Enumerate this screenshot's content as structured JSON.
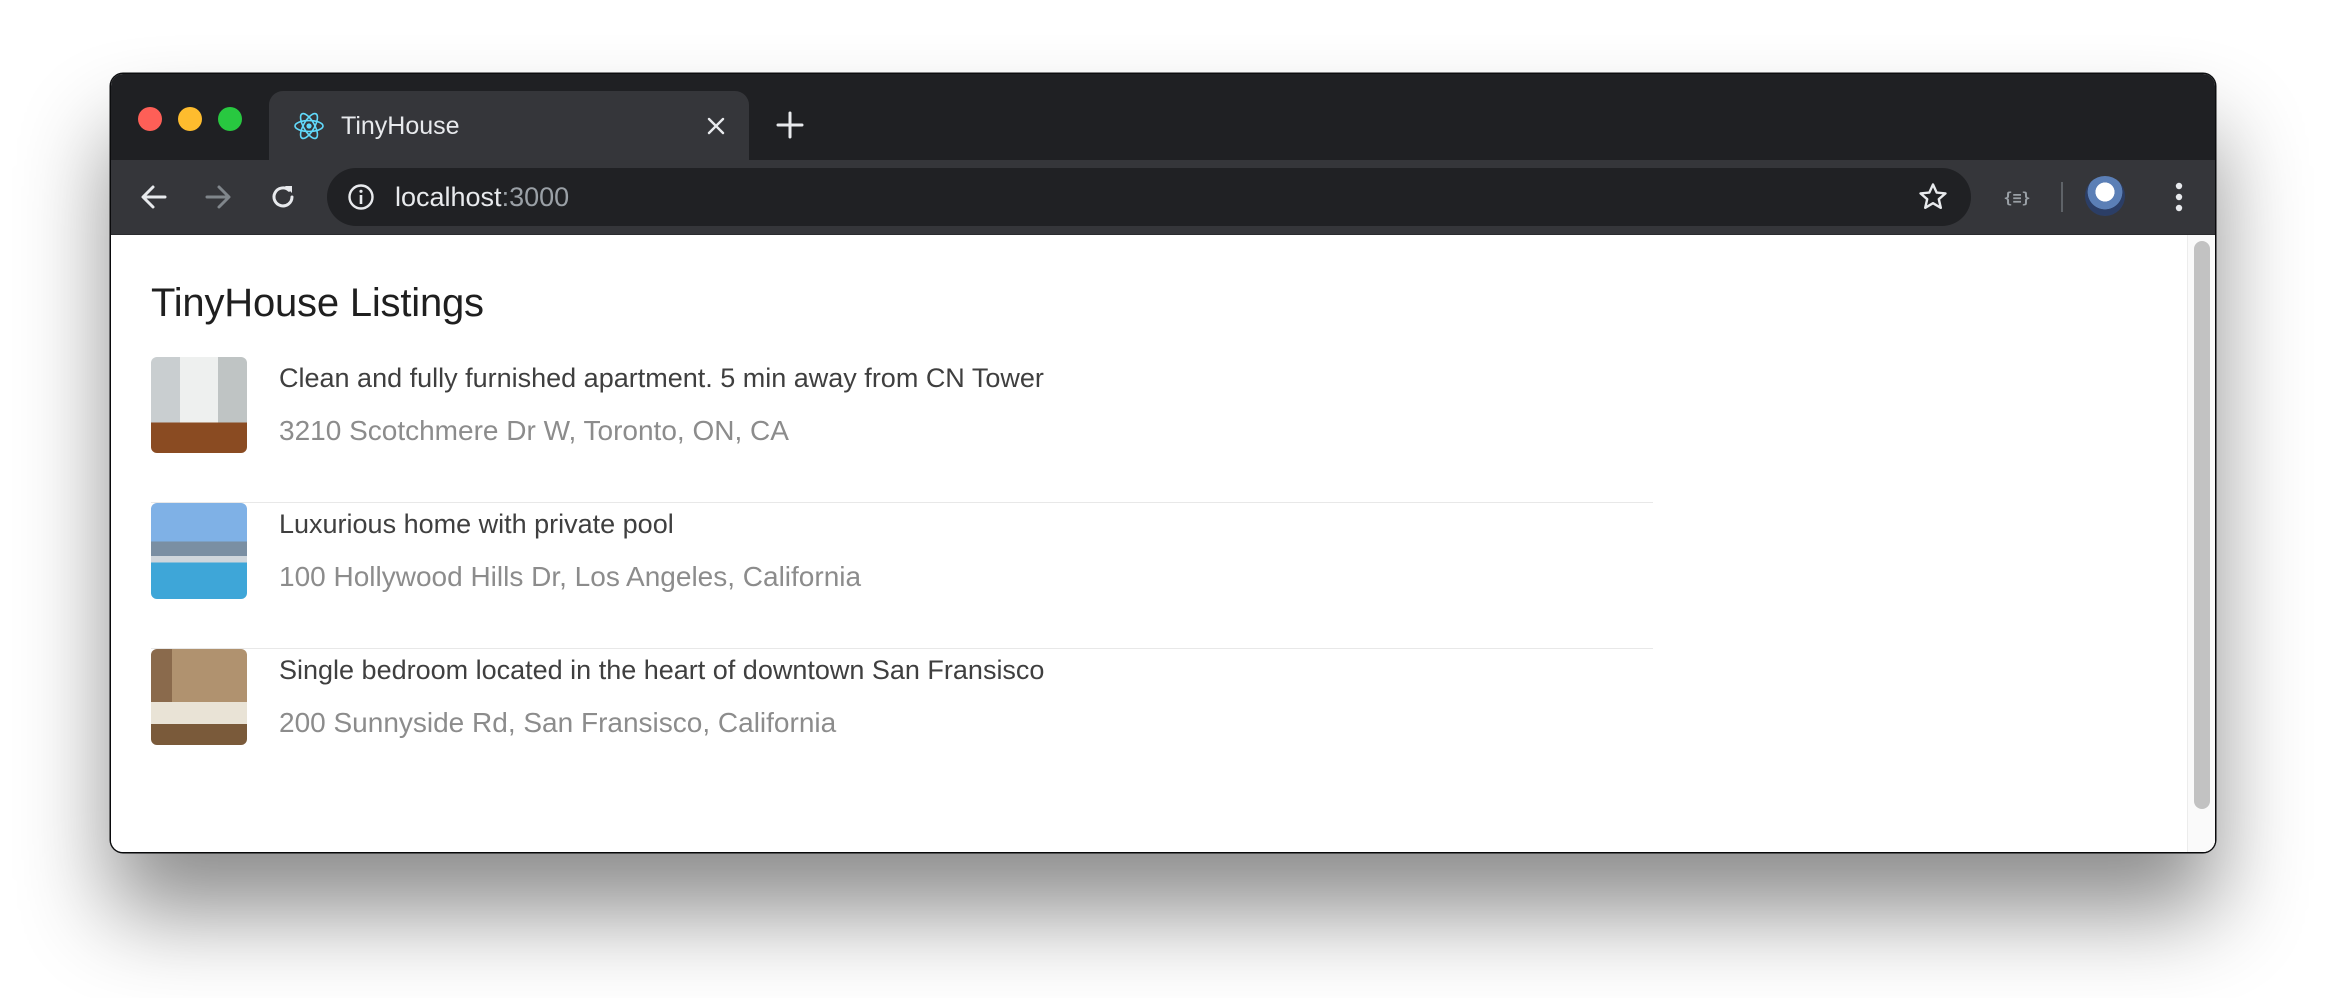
{
  "browser": {
    "tab": {
      "title": "TinyHouse",
      "favicon": "react-atom-icon"
    },
    "address_bar": {
      "host": "localhost",
      "port": ":3000"
    },
    "icons": {
      "back": "arrow-left-icon",
      "forward": "arrow-right-icon",
      "reload": "reload-icon",
      "info": "info-icon",
      "bookmark": "star-icon",
      "extension": "json-viewer-icon",
      "menu": "kebab-menu-icon"
    }
  },
  "page": {
    "title": "TinyHouse Listings",
    "listings": [
      {
        "title": "Clean and fully furnished apartment. 5 min away from CN Tower",
        "address": "3210 Scotchmere Dr W, Toronto, ON, CA"
      },
      {
        "title": "Luxurious home with private pool",
        "address": "100 Hollywood Hills Dr, Los Angeles, California"
      },
      {
        "title": "Single bedroom located in the heart of downtown San Fransisco",
        "address": "200 Sunnyside Rd, San Fransisco, California"
      }
    ]
  },
  "colors": {
    "titlebar": "#1f2023",
    "toolbar": "#35363a",
    "omnibox": "#202124",
    "react_blue": "#61dafb"
  }
}
